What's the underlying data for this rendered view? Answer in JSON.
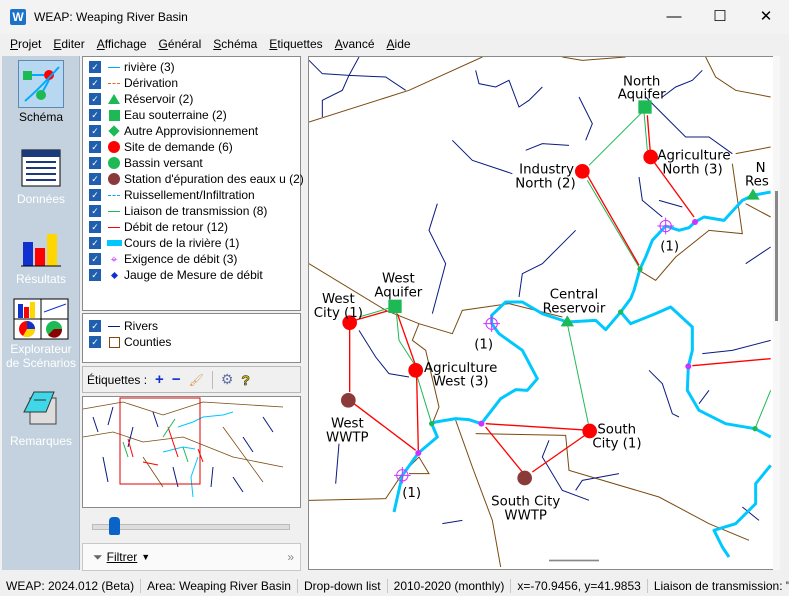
{
  "window": {
    "title": "WEAP: Weaping River Basin",
    "logo": "W",
    "minimize": "—",
    "maximize": "☐",
    "close": "✕"
  },
  "menu": [
    "Projet",
    "Editer",
    "Affichage",
    "Général",
    "Schéma",
    "Etiquettes",
    "Avancé",
    "Aide"
  ],
  "nav": [
    {
      "label": "Schéma",
      "icon": "schematic-icon"
    },
    {
      "label": "Données",
      "icon": "data-icon"
    },
    {
      "label": "Résultats",
      "icon": "results-icon"
    },
    {
      "label": "Explorateur de Scénarios",
      "icon": "scenario-explorer-icon"
    },
    {
      "label": "Remarques",
      "icon": "notes-icon"
    }
  ],
  "legend": [
    {
      "label": "rivière (3)",
      "sym": "line",
      "color": "#00aaff"
    },
    {
      "label": "Dérivation",
      "sym": "dash",
      "color": "#e07020"
    },
    {
      "label": "Réservoir (2)",
      "sym": "triangle",
      "color": "#1db954"
    },
    {
      "label": "Eau souterraine (2)",
      "sym": "square",
      "color": "#1db954"
    },
    {
      "label": "Autre Approvisionnement",
      "sym": "diamond",
      "color": "#1db954"
    },
    {
      "label": "Site de demande (6)",
      "sym": "circle",
      "color": "#ff0000"
    },
    {
      "label": "Bassin versant",
      "sym": "circle",
      "color": "#1db954"
    },
    {
      "label": "Station d'épuration des eaux u (2)",
      "sym": "circle",
      "color": "#8b3a3a"
    },
    {
      "label": "Ruissellement/Infiltration",
      "sym": "dash",
      "color": "#00aaff"
    },
    {
      "label": "Liaison de transmission (8)",
      "sym": "line",
      "color": "#1db954"
    },
    {
      "label": "Débit de retour (12)",
      "sym": "line",
      "color": "#ff0000"
    },
    {
      "label": "Cours de la rivière (1)",
      "sym": "thick",
      "color": "#00c8ff"
    },
    {
      "label": "Exigence de débit (3)",
      "sym": "target",
      "color": "#cc33ff"
    },
    {
      "label": "Jauge de Mesure de débit",
      "sym": "gauge",
      "color": "#1030d0"
    }
  ],
  "layers": [
    {
      "label": "Rivers",
      "color": "#0a1a80"
    },
    {
      "label": "Counties",
      "color": "#7a4a10"
    }
  ],
  "labels_toolbar": {
    "label": "Étiquettes :",
    "add": "+",
    "remove": "−"
  },
  "slider": {
    "value": 0.1
  },
  "filter": {
    "label": "Filtrer",
    "more": "»"
  },
  "map": {
    "nodes": {
      "north_aquifer": [
        "North",
        "Aquifer"
      ],
      "industry_north": [
        "Industry",
        "North (2)"
      ],
      "agriculture_north": [
        "Agriculture",
        "North (3)"
      ],
      "north_reservoir": [
        "N",
        "Res"
      ],
      "central_reservoir": [
        "Central",
        "Reservoir"
      ],
      "west_aquifer": [
        "West",
        "Aquifer"
      ],
      "west_city": [
        "West",
        "City (1)"
      ],
      "agriculture_west": [
        "Agriculture",
        "West (3)"
      ],
      "west_wwtp": [
        "West",
        "WWTP"
      ],
      "south_city": [
        "South",
        "City (1)"
      ],
      "south_city_wwtp": [
        "South City",
        "WWTP"
      ],
      "flow_req": "(1)"
    }
  },
  "status": [
    "WEAP: 2024.012 (Beta)",
    "Area: Weaping River Basin",
    "Drop-down list",
    "2010-2020 (monthly)",
    "x=-70.9456, y=41.9853",
    "Liaison de transmission: \"Noe"
  ]
}
